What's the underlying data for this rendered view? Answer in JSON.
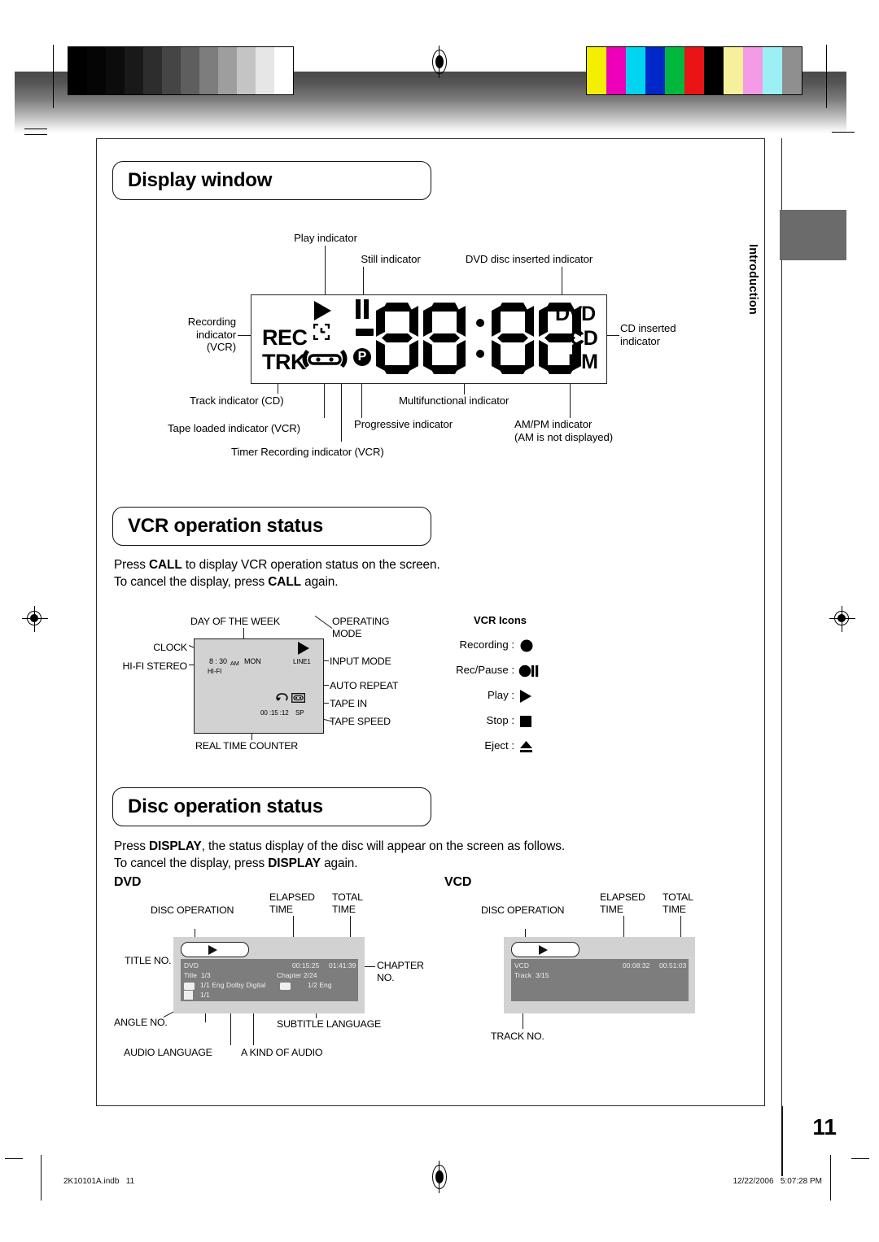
{
  "page": {
    "number": "11",
    "side_tab": "Introduction",
    "footer_left": "2K10101A.indb   11",
    "footer_right": "12/22/2006   5:07:28 PM"
  },
  "sections": {
    "display_window": {
      "title": "Display window"
    },
    "vcr_operation": {
      "title": "VCR operation status",
      "body_line1_pre": "Press ",
      "body_line1_bold": "CALL",
      "body_line1_post": " to display VCR operation status on the screen.",
      "body_line2_pre": "To cancel the display, press ",
      "body_line2_bold": "CALL",
      "body_line2_post": " again."
    },
    "disc_operation": {
      "title": "Disc operation status",
      "body_line1_pre": "Press ",
      "body_line1_bold": "DISPLAY",
      "body_line1_post": ", the status display of the disc will appear on the screen as follows.",
      "body_line2_pre": "To cancel the display, press ",
      "body_line2_bold": "DISPLAY",
      "body_line2_post": " again."
    }
  },
  "display_window_diagram": {
    "callouts": {
      "play": "Play indicator",
      "still": "Still indicator",
      "dvd_inserted": "DVD disc inserted indicator",
      "recording": "Recording\nindicator\n(VCR)",
      "cd_inserted": "CD inserted\nindicator",
      "track": "Track indicator (CD)",
      "tape_loaded": "Tape loaded indicator (VCR)",
      "timer_recording": "Timer Recording indicator (VCR)",
      "progressive": "Progressive indicator",
      "multifunctional": "Multifunctional indicator",
      "ampm": "AM/PM indicator\n(AM is not displayed)"
    },
    "segments": {
      "rec": "REC",
      "trk": "TRK",
      "dvd": "DVD",
      "cd": "CD",
      "pm": "PM",
      "progressive_letter": "P",
      "digits": "88:88"
    }
  },
  "vcr_status_diagram": {
    "callouts": {
      "day_of_week": "DAY OF THE WEEK",
      "operating_mode": "OPERATING\nMODE",
      "clock": "CLOCK",
      "hifi_stereo": "HI-FI STEREO",
      "input_mode": "INPUT MODE",
      "auto_repeat": "AUTO REPEAT",
      "tape_in": "TAPE IN",
      "tape_speed": "TAPE SPEED",
      "real_time_counter": "REAL TIME COUNTER"
    },
    "screen": {
      "clock": "8 : 30",
      "clock_ampm": "AM",
      "day": "MON",
      "hifi": "HI-FI",
      "input": "LINE1",
      "counter": "00 :15 :12",
      "speed": "SP"
    }
  },
  "vcr_icons": {
    "heading": "VCR Icons",
    "items": [
      {
        "label": "Recording :",
        "icon": "record-circle-icon"
      },
      {
        "label": "Rec/Pause :",
        "icon": "record-pause-icon"
      },
      {
        "label": "Play :",
        "icon": "play-triangle-icon"
      },
      {
        "label": "Stop :",
        "icon": "stop-square-icon"
      },
      {
        "label": "Eject :",
        "icon": "eject-triangle-icon"
      }
    ]
  },
  "disc_status": {
    "dvd": {
      "heading": "DVD",
      "callouts": {
        "disc_operation": "DISC OPERATION",
        "elapsed_time": "ELAPSED\nTIME",
        "total_time": "TOTAL\nTIME",
        "title_no": "TITLE NO.",
        "chapter_no": "CHAPTER\nNO.",
        "angle_no": "ANGLE NO.",
        "subtitle_language": "SUBTITLE LANGUAGE",
        "audio_language": "AUDIO LANGUAGE",
        "kind_of_audio": "A KIND OF AUDIO"
      },
      "osd": {
        "disc_type": "DVD",
        "elapsed": "00:15:25",
        "total": "01:41:39",
        "title": "Title  1/3",
        "chapter": "Chapter 2/24",
        "audio": "1/1 Eng Dolby Digital",
        "subtitle": "1/2 Eng",
        "angle": "1/1"
      }
    },
    "vcd": {
      "heading": "VCD",
      "callouts": {
        "disc_operation": "DISC OPERATION",
        "elapsed_time": "ELAPSED\nTIME",
        "total_time": "TOTAL\nTIME",
        "track_no": "TRACK NO."
      },
      "osd": {
        "disc_type": "VCD",
        "elapsed": "00:08:32",
        "total": "00:51:03",
        "track": "Track  3/15"
      }
    }
  },
  "print_marks": {
    "gray_ramp": [
      "#000000",
      "#050505",
      "#0c0c0c",
      "#191919",
      "#2d2d2d",
      "#454545",
      "#5e5e5e",
      "#7d7d7d",
      "#9e9e9e",
      "#c4c4c4",
      "#e6e6e6",
      "#ffffff"
    ],
    "color_patches": [
      "#f4ef00",
      "#ec00b9",
      "#00d4ef",
      "#0028c8",
      "#00b83e",
      "#e81416",
      "#000000",
      "#f6f09a",
      "#f49ae6",
      "#9cf0f4",
      "#8f8f8f"
    ]
  }
}
